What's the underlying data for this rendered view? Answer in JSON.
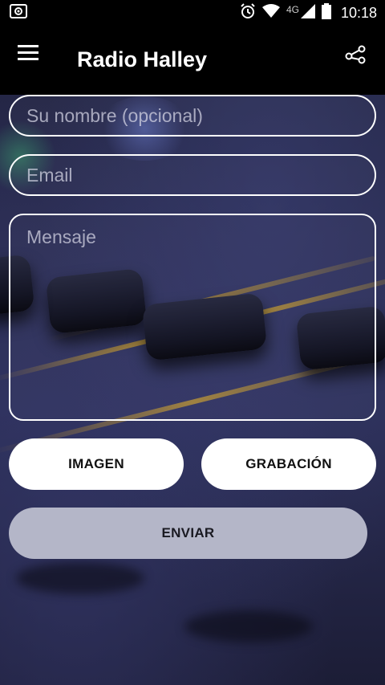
{
  "status_bar": {
    "left_icon": "screenshot-icon",
    "network_label": "4G",
    "time": "10:18",
    "icons": [
      "alarm-icon",
      "wifi-icon",
      "signal-icon",
      "battery-icon"
    ]
  },
  "app_bar": {
    "title": "Radio Halley",
    "menu_icon": "hamburger-menu-icon",
    "share_icon": "share-icon"
  },
  "form": {
    "name_placeholder": "Su nombre (opcional)",
    "email_placeholder": "Email",
    "message_placeholder": "Mensaje",
    "image_button": "IMAGEN",
    "recording_button": "GRABACIÓN",
    "send_button": "ENVIAR"
  },
  "colors": {
    "accent_button": "#ffffff",
    "send_button": "#b4b6c8",
    "field_border": "#ffffff"
  }
}
